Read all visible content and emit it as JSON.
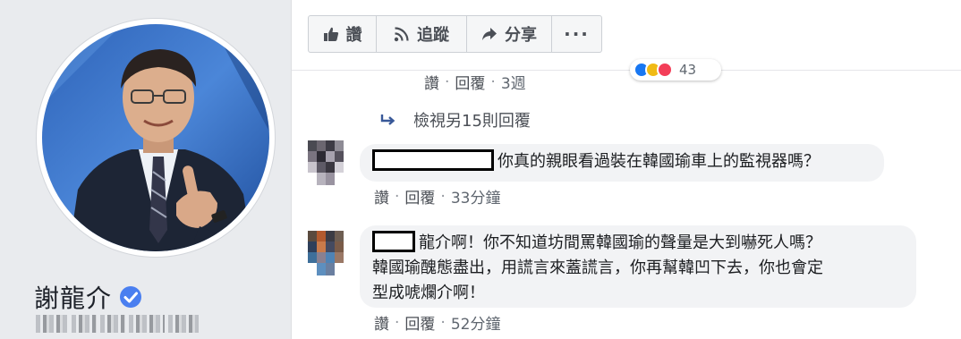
{
  "profile": {
    "name": "謝龍介",
    "verified_icon": "verified-badge-icon",
    "accent": "#4a7ff0"
  },
  "actions": [
    {
      "label": "讚",
      "icon": "thumbs-up-icon"
    },
    {
      "label": "追蹤",
      "icon": "rss-icon"
    },
    {
      "label": "分享",
      "icon": "share-arrow-icon"
    },
    {
      "label": "···",
      "icon": "more-icon"
    }
  ],
  "first_comment": {
    "like": "讚",
    "reply": "回覆",
    "time": "3週",
    "reaction_count": "43"
  },
  "view_more": {
    "label": "檢視另15則回覆",
    "icon": "reply-arrow-icon"
  },
  "comments": [
    {
      "text": "你真的親眼看過裝在韓國瑜車上的監視器嗎？",
      "like": "讚",
      "reply": "回覆",
      "time": "33分鐘"
    },
    {
      "text_line1": "龍介啊！你不知道坊間罵韓國瑜的聲量是大到嚇死人嗎？",
      "text_line2": "韓國瑜醜態盡出，用謊言來蓋謊言，你再幫韓凹下去，你也會定",
      "text_line3": "型成唬爛介啊！",
      "like": "讚",
      "reply": "回覆",
      "time": "52分鐘"
    }
  ],
  "colors": {
    "link": "#385898",
    "meta": "#606770",
    "bubble": "#f2f3f5",
    "sidebar": "#e9ebee"
  }
}
